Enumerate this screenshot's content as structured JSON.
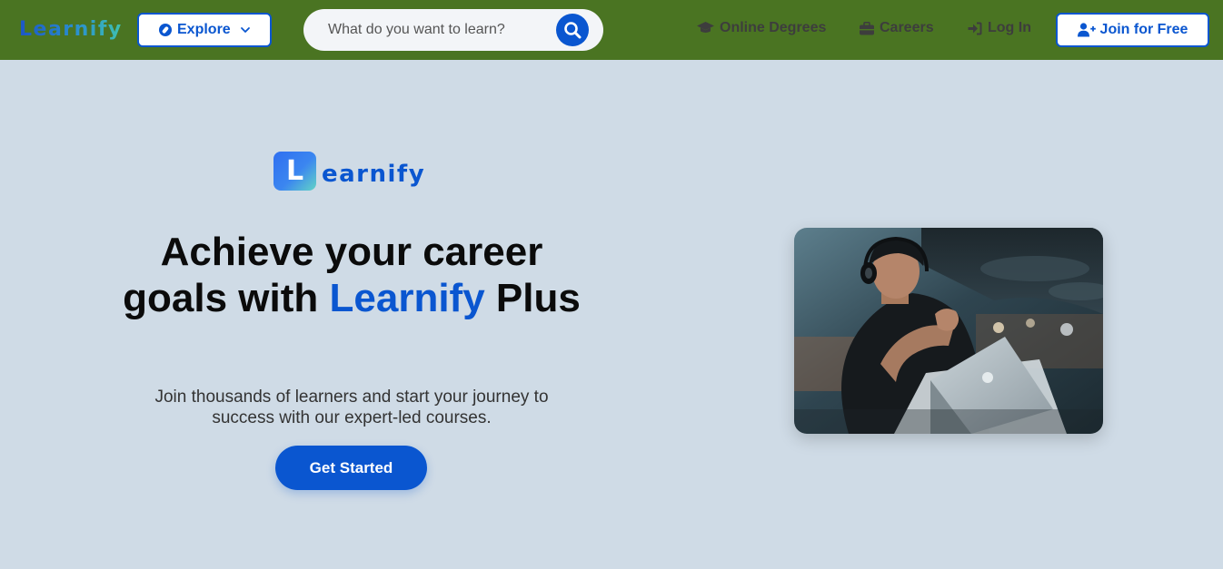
{
  "navbar": {
    "brand": "Learnify",
    "explore_label": "Explore",
    "search_placeholder": "What do you want to learn?",
    "links": {
      "online_degrees": "Online Degrees",
      "careers": "Careers",
      "login": "Log In"
    },
    "join_label": "Join for Free"
  },
  "hero": {
    "logo_letter": "L",
    "logo_word": "earnify",
    "title_part1": "Achieve your career goals with ",
    "title_accent": "Learnify",
    "title_part2": " Plus",
    "subtitle": "Join thousands of learners and start your journey to success with our expert-led courses.",
    "cta_label": "Get Started"
  },
  "icons": {
    "explore": "compass-icon",
    "explore_caret": "chevron-down-icon",
    "search": "search-icon",
    "online_degrees": "graduation-cap-icon",
    "careers": "briefcase-icon",
    "login": "sign-in-icon",
    "join": "user-plus-icon"
  },
  "colors": {
    "navbar": "#4a7422",
    "accent": "#0a56d0",
    "page_bg": "#cfdbe6"
  }
}
